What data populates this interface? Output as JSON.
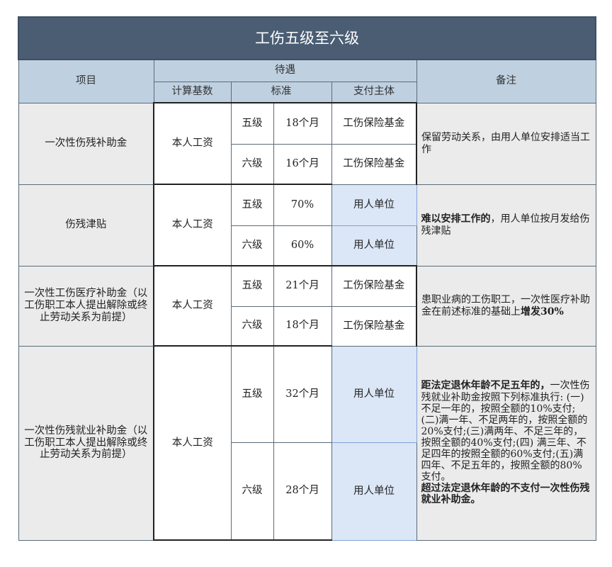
{
  "title": "工伤五级至六级",
  "headers": {
    "item": "项目",
    "benefit": "待遇",
    "base": "计算基数",
    "standard": "标准",
    "payer": "支付主体",
    "note": "备注"
  },
  "rows": [
    {
      "item": "一次性伤残补助金",
      "base": "本人工资",
      "levels": [
        {
          "grade": "五级",
          "standard": "18个月",
          "payer": "工伤保险基金"
        },
        {
          "grade": "六级",
          "standard": "16个月",
          "payer": "工伤保险基金"
        }
      ],
      "note": "保留劳动关系，由用人单位安排适当工作"
    },
    {
      "item": "伤残津贴",
      "base": "本人工资",
      "levels": [
        {
          "grade": "五级",
          "standard": "70%",
          "payer": "用人单位"
        },
        {
          "grade": "六级",
          "standard": "60%",
          "payer": "用人单位"
        }
      ],
      "note_bold": "难以安排工作的",
      "note_rest": "，用人单位按月发给伤残津贴"
    },
    {
      "item": "一次性工伤医疗补助金（以工伤职工本人提出解除或终止劳动关系为前提）",
      "base": "本人工资",
      "levels": [
        {
          "grade": "五级",
          "standard": "21个月",
          "payer": "工伤保险基金"
        },
        {
          "grade": "六级",
          "standard": "18个月",
          "payer": "工伤保险基金"
        }
      ],
      "note_rest": "患职业病的工伤职工，一次性医疗补助金在前述标准的基础上",
      "note_bold": "增发30%"
    },
    {
      "item": "一次性伤残就业补助金（以工伤职工本人提出解除或终止劳动关系为前提）",
      "base": "本人工资",
      "levels": [
        {
          "grade": "五级",
          "standard": "32个月",
          "payer": "用人单位"
        },
        {
          "grade": "六级",
          "standard": "28个月",
          "payer": "用人单位"
        }
      ],
      "note_bold_1": "距法定退休年龄不足五年的，",
      "note_mid": "一次性伤残就业补助金按照下列标准执行: (一)不足一年的，按照全额的10%支付;(二)满一年、不足两年的，按照全额的20%支付;(三)满两年、不足三年的，按照全额的40%支付;(四) 满三年、不足四年的按照全额的60%支付;(五)满四年、不足五年的，按照全额的80%支付。",
      "note_bold_2": "超过法定退休年龄的不支付一次性伤残就业补助金。"
    }
  ]
}
